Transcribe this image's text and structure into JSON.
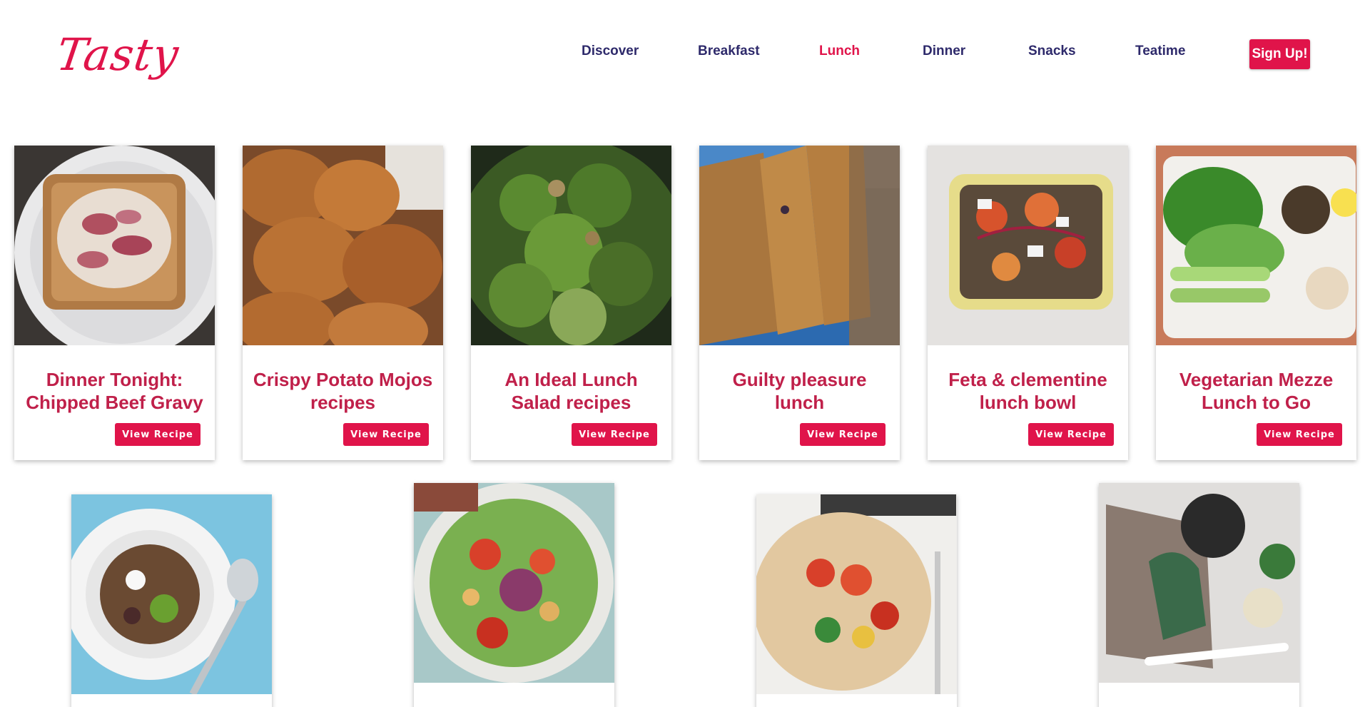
{
  "brand": {
    "logo_text": "Tasty",
    "accent": "#e0144a",
    "nav_color": "#2e2a6b"
  },
  "nav": {
    "items": [
      {
        "label": "Discover",
        "active": false
      },
      {
        "label": "Breakfast",
        "active": false
      },
      {
        "label": "Lunch",
        "active": true
      },
      {
        "label": "Dinner",
        "active": false
      },
      {
        "label": "Snacks",
        "active": false
      },
      {
        "label": "Teatime",
        "active": false
      }
    ],
    "signup_label": "Sign Up!"
  },
  "recipes": [
    {
      "title": "Dinner Tonight: Chipped Beef Gravy",
      "button": "View Recipe"
    },
    {
      "title": "Crispy Potato Mojos recipes",
      "button": "View Recipe"
    },
    {
      "title": "An Ideal Lunch Salad recipes",
      "button": "View Recipe"
    },
    {
      "title": "Guilty pleasure lunch",
      "button": "View Recipe"
    },
    {
      "title": "Feta & clementine lunch bowl",
      "button": "View Recipe"
    },
    {
      "title": "Vegetarian Mezze Lunch to Go",
      "button": "View Recipe"
    }
  ]
}
